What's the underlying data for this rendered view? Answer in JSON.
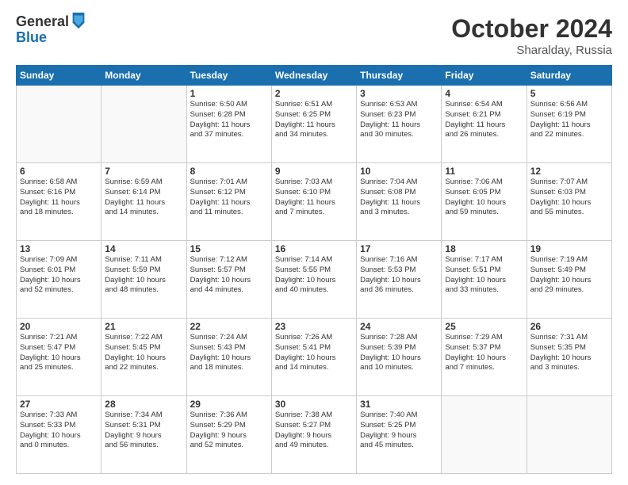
{
  "logo": {
    "general": "General",
    "blue": "Blue"
  },
  "title": {
    "month": "October 2024",
    "location": "Sharalday, Russia"
  },
  "weekdays": [
    "Sunday",
    "Monday",
    "Tuesday",
    "Wednesday",
    "Thursday",
    "Friday",
    "Saturday"
  ],
  "weeks": [
    [
      {
        "day": "",
        "text": ""
      },
      {
        "day": "",
        "text": ""
      },
      {
        "day": "1",
        "text": "Sunrise: 6:50 AM\nSunset: 6:28 PM\nDaylight: 11 hours\nand 37 minutes."
      },
      {
        "day": "2",
        "text": "Sunrise: 6:51 AM\nSunset: 6:25 PM\nDaylight: 11 hours\nand 34 minutes."
      },
      {
        "day": "3",
        "text": "Sunrise: 6:53 AM\nSunset: 6:23 PM\nDaylight: 11 hours\nand 30 minutes."
      },
      {
        "day": "4",
        "text": "Sunrise: 6:54 AM\nSunset: 6:21 PM\nDaylight: 11 hours\nand 26 minutes."
      },
      {
        "day": "5",
        "text": "Sunrise: 6:56 AM\nSunset: 6:19 PM\nDaylight: 11 hours\nand 22 minutes."
      }
    ],
    [
      {
        "day": "6",
        "text": "Sunrise: 6:58 AM\nSunset: 6:16 PM\nDaylight: 11 hours\nand 18 minutes."
      },
      {
        "day": "7",
        "text": "Sunrise: 6:59 AM\nSunset: 6:14 PM\nDaylight: 11 hours\nand 14 minutes."
      },
      {
        "day": "8",
        "text": "Sunrise: 7:01 AM\nSunset: 6:12 PM\nDaylight: 11 hours\nand 11 minutes."
      },
      {
        "day": "9",
        "text": "Sunrise: 7:03 AM\nSunset: 6:10 PM\nDaylight: 11 hours\nand 7 minutes."
      },
      {
        "day": "10",
        "text": "Sunrise: 7:04 AM\nSunset: 6:08 PM\nDaylight: 11 hours\nand 3 minutes."
      },
      {
        "day": "11",
        "text": "Sunrise: 7:06 AM\nSunset: 6:05 PM\nDaylight: 10 hours\nand 59 minutes."
      },
      {
        "day": "12",
        "text": "Sunrise: 7:07 AM\nSunset: 6:03 PM\nDaylight: 10 hours\nand 55 minutes."
      }
    ],
    [
      {
        "day": "13",
        "text": "Sunrise: 7:09 AM\nSunset: 6:01 PM\nDaylight: 10 hours\nand 52 minutes."
      },
      {
        "day": "14",
        "text": "Sunrise: 7:11 AM\nSunset: 5:59 PM\nDaylight: 10 hours\nand 48 minutes."
      },
      {
        "day": "15",
        "text": "Sunrise: 7:12 AM\nSunset: 5:57 PM\nDaylight: 10 hours\nand 44 minutes."
      },
      {
        "day": "16",
        "text": "Sunrise: 7:14 AM\nSunset: 5:55 PM\nDaylight: 10 hours\nand 40 minutes."
      },
      {
        "day": "17",
        "text": "Sunrise: 7:16 AM\nSunset: 5:53 PM\nDaylight: 10 hours\nand 36 minutes."
      },
      {
        "day": "18",
        "text": "Sunrise: 7:17 AM\nSunset: 5:51 PM\nDaylight: 10 hours\nand 33 minutes."
      },
      {
        "day": "19",
        "text": "Sunrise: 7:19 AM\nSunset: 5:49 PM\nDaylight: 10 hours\nand 29 minutes."
      }
    ],
    [
      {
        "day": "20",
        "text": "Sunrise: 7:21 AM\nSunset: 5:47 PM\nDaylight: 10 hours\nand 25 minutes."
      },
      {
        "day": "21",
        "text": "Sunrise: 7:22 AM\nSunset: 5:45 PM\nDaylight: 10 hours\nand 22 minutes."
      },
      {
        "day": "22",
        "text": "Sunrise: 7:24 AM\nSunset: 5:43 PM\nDaylight: 10 hours\nand 18 minutes."
      },
      {
        "day": "23",
        "text": "Sunrise: 7:26 AM\nSunset: 5:41 PM\nDaylight: 10 hours\nand 14 minutes."
      },
      {
        "day": "24",
        "text": "Sunrise: 7:28 AM\nSunset: 5:39 PM\nDaylight: 10 hours\nand 10 minutes."
      },
      {
        "day": "25",
        "text": "Sunrise: 7:29 AM\nSunset: 5:37 PM\nDaylight: 10 hours\nand 7 minutes."
      },
      {
        "day": "26",
        "text": "Sunrise: 7:31 AM\nSunset: 5:35 PM\nDaylight: 10 hours\nand 3 minutes."
      }
    ],
    [
      {
        "day": "27",
        "text": "Sunrise: 7:33 AM\nSunset: 5:33 PM\nDaylight: 10 hours\nand 0 minutes."
      },
      {
        "day": "28",
        "text": "Sunrise: 7:34 AM\nSunset: 5:31 PM\nDaylight: 9 hours\nand 56 minutes."
      },
      {
        "day": "29",
        "text": "Sunrise: 7:36 AM\nSunset: 5:29 PM\nDaylight: 9 hours\nand 52 minutes."
      },
      {
        "day": "30",
        "text": "Sunrise: 7:38 AM\nSunset: 5:27 PM\nDaylight: 9 hours\nand 49 minutes."
      },
      {
        "day": "31",
        "text": "Sunrise: 7:40 AM\nSunset: 5:25 PM\nDaylight: 9 hours\nand 45 minutes."
      },
      {
        "day": "",
        "text": ""
      },
      {
        "day": "",
        "text": ""
      }
    ]
  ]
}
